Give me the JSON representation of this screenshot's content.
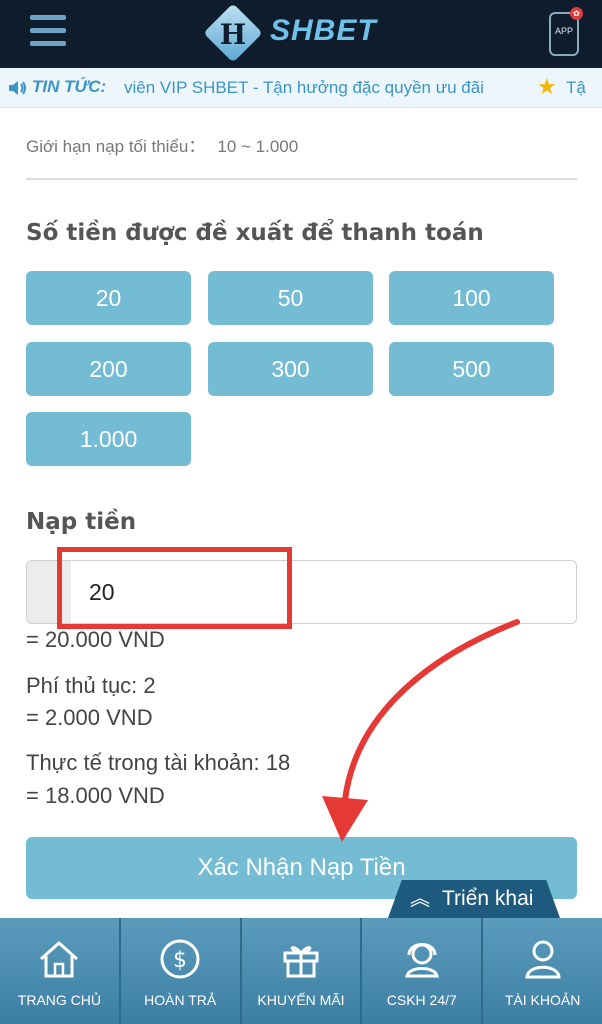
{
  "header": {
    "logo_letter": "H",
    "logo_text": "SHBET",
    "app_label": "APP"
  },
  "ticker": {
    "label": "TIN TỨC:",
    "text": "viên VIP SHBET - Tận hưởng đặc quyền ưu đãi",
    "more": "Tậ"
  },
  "deposit": {
    "min_limit_label": "Giới hạn nạp tối thiểu：",
    "min_limit_value": "10 ~ 1.000",
    "suggested_title": "Số tiền được đề xuất để thanh toán",
    "amounts": [
      "20",
      "50",
      "100",
      "200",
      "300",
      "500",
      "1.000"
    ],
    "input_title": "Nạp tiền",
    "input_value": "20",
    "converted": "= 20.000 VND",
    "fee_label": "Phí thủ tục: 2",
    "fee_converted": "= 2.000 VND",
    "actual_label": "Thực tế trong tài khoản: 18",
    "actual_converted": "= 18.000 VND",
    "confirm_label": "Xác Nhận Nạp Tiền",
    "expand_label": "Triển khai"
  },
  "bottom_nav": [
    {
      "label": "TRANG CHỦ",
      "icon": "home-icon"
    },
    {
      "label": "HOÀN TRẢ",
      "icon": "dollar-icon"
    },
    {
      "label": "KHUYẾN MÃI",
      "icon": "gift-icon"
    },
    {
      "label": "CSKH 24/7",
      "icon": "support-icon"
    },
    {
      "label": "TÀI KHOẢN",
      "icon": "user-icon"
    }
  ],
  "colors": {
    "header_bg": "#0f1c2b",
    "accent": "#74bcd4",
    "annotation": "#e53935",
    "nav_bg": "#4a8db0"
  }
}
